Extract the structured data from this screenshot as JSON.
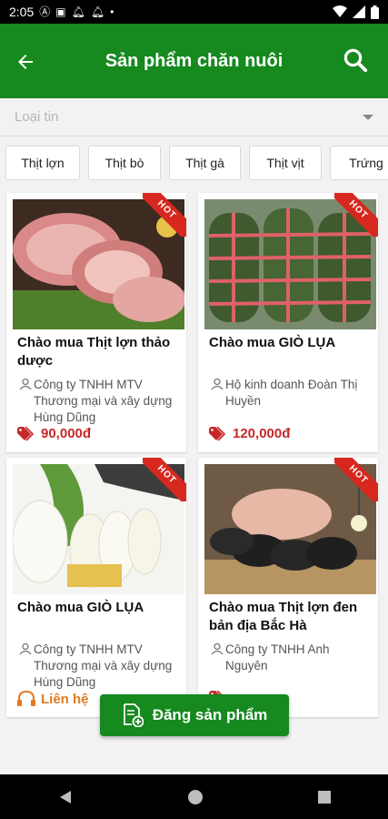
{
  "status_bar": {
    "time": "2:05"
  },
  "header": {
    "title": "Sản phẩm chăn nuôi"
  },
  "filter": {
    "placeholder": "Loại tin"
  },
  "categories": [
    "Thịt lợn",
    "Thịt bò",
    "Thịt gà",
    "Thịt vịt",
    "Trứng"
  ],
  "badge": {
    "hot": "HOT"
  },
  "products": [
    {
      "name": "Chào mua Thịt lợn thảo dược",
      "seller": "Công ty TNHH MTV Thương mại và xây dựng Hùng Dũng",
      "price": "90,000đ",
      "image_icon": "pork-meat-image"
    },
    {
      "name": "Chào mua GIÒ LỤA",
      "seller": "Hộ kinh doanh Đoàn Thị Huyền",
      "price": "120,000đ",
      "image_icon": "gio-lua-wrapped-image"
    },
    {
      "name": "Chào mua GIÒ LỤA",
      "seller": "Công ty TNHH MTV Thương mại và xây dựng Hùng Dũng",
      "price": "Liên hệ",
      "image_icon": "gio-lua-sliced-image"
    },
    {
      "name": "Chào mua Thịt lợn đen bản địa Bắc Hà",
      "seller": "Công ty TNHH Anh Nguyên",
      "price": "",
      "image_icon": "black-pigs-image"
    }
  ],
  "fab": {
    "label": "Đăng sản phẩm"
  },
  "colors": {
    "primary": "#16891f",
    "price": "#c62828",
    "contact": "#e07a1f",
    "hot": "#d6281f"
  }
}
